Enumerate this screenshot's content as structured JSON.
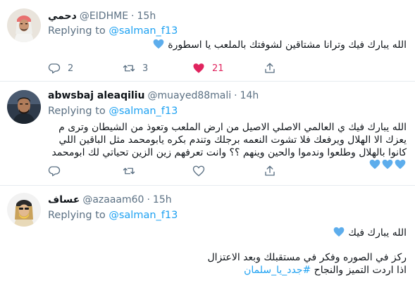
{
  "tweets": [
    {
      "name": "دحمي",
      "handle": "@EIDHME",
      "dot": "·",
      "time": "15h",
      "replying_prefix": "Replying to",
      "replying_to": "@salman_f13",
      "text": "الله يبارك فيك وترانا مشتاقين لشوفتك بالملعب يا اسطورة",
      "reply_count": "2",
      "retweet_count": "3",
      "like_count": "21",
      "liked": true
    },
    {
      "name": "abwsbaj aleaqiliu",
      "handle": "@muayed88mali",
      "dot": "·",
      "time": "14h",
      "replying_prefix": "Replying to",
      "replying_to": "@salman_f13",
      "text": "الله يبارك فيك ي العالمي الاصلي الاصيل من ارض الملعب وتعوذ من الشيطان وترى م يعزك الا الهلال ويرفعك فلا تشوت النعمه برجلك وتندم بكره يابومحمد مثل الباقين اللي كانوا بالهلال وطلعوا وندموا والحين وينهم ؟؟ وانت تعرفهم زين الزين تحياتي لك ابومحمد",
      "reply_count": "",
      "retweet_count": "",
      "like_count": "",
      "liked": false
    },
    {
      "name": "عساف",
      "handle": "@azaaam60",
      "dot": "·",
      "time": "15h",
      "replying_prefix": "Replying to",
      "replying_to": "@salman_f13",
      "line1": "الله يبارك فيك",
      "line2": "ركز في الصوره وفكر في مستقبلك وبعد الاعتزال",
      "line3": "اذا اردت التميز والنجاح",
      "hashtag": "#جدد_يا_سلمان"
    }
  ],
  "colors": {
    "accent": "#1da1f2",
    "muted": "#5b7083",
    "like": "#e0245e",
    "heart_emoji": "#5dadec",
    "divider": "#e6ecf0"
  },
  "icons": [
    "reply-icon",
    "retweet-icon",
    "like-icon",
    "share-icon",
    "blue-heart-emoji"
  ]
}
